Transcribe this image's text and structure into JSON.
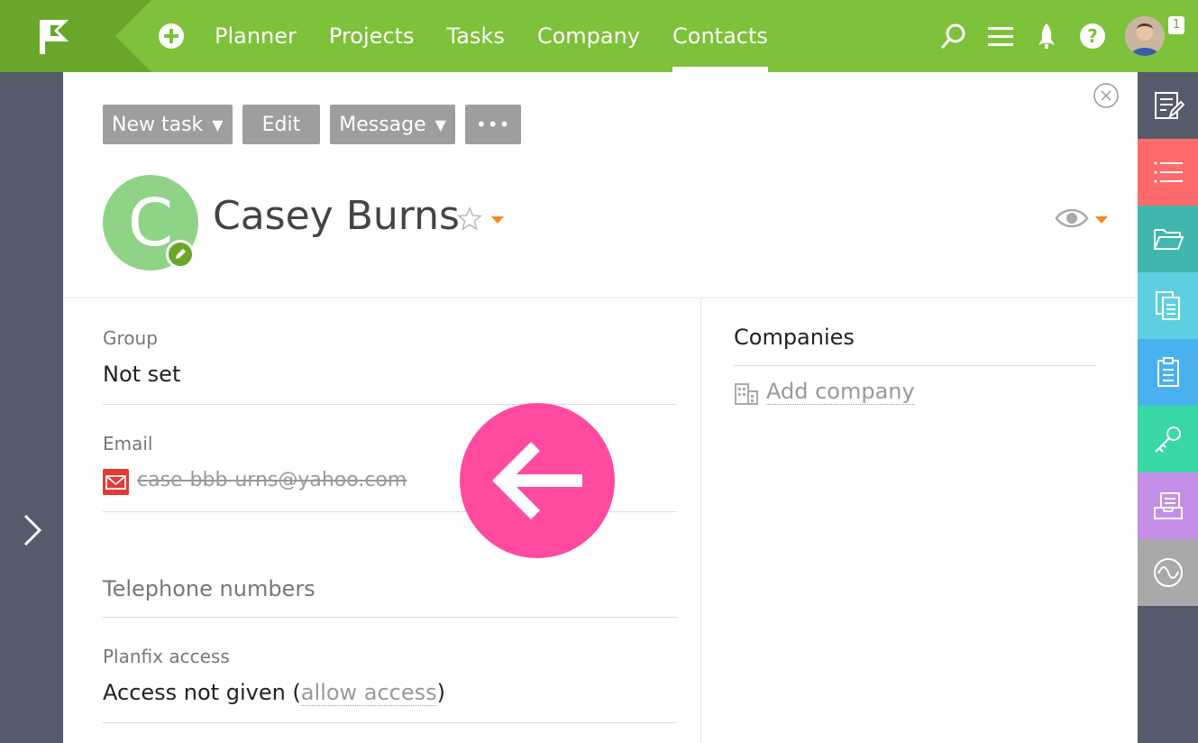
{
  "nav": {
    "items": [
      {
        "label": "Planner",
        "active": false
      },
      {
        "label": "Projects",
        "active": false
      },
      {
        "label": "Tasks",
        "active": false
      },
      {
        "label": "Company",
        "active": false
      },
      {
        "label": "Contacts",
        "active": true
      }
    ],
    "notification_count": "1"
  },
  "toolbar": {
    "new_task": "New task",
    "edit": "Edit",
    "message": "Message",
    "more": "•••",
    "caret": "▼"
  },
  "contact": {
    "initial": "C",
    "name": "Casey Burns"
  },
  "fields": {
    "group_label": "Group",
    "group_value": "Not set",
    "email_label": "Email",
    "email_value": "case-bbb-urns@yahoo.com",
    "telephone_label": "Telephone numbers",
    "access_label": "Planfix access",
    "access_value_prefix": "Access not given (",
    "access_link": "allow access",
    "access_value_suffix": ")"
  },
  "companies": {
    "title": "Companies",
    "add_company": "Add company"
  },
  "colors": {
    "topbar": "#7ec13a",
    "accent_orange": "#f28a1e",
    "pink_arrow": "#ff4aa0",
    "avatar_green": "#8fd387"
  },
  "right_sidebar": [
    {
      "icon": "notes-icon",
      "color": "#545b6b"
    },
    {
      "icon": "list-icon",
      "color": "#ff6b6b"
    },
    {
      "icon": "folder-icon",
      "color": "#3fb7ac"
    },
    {
      "icon": "documents-icon",
      "color": "#5cd0e0"
    },
    {
      "icon": "clipboard-icon",
      "color": "#48b1ee"
    },
    {
      "icon": "key-icon",
      "color": "#3ad8a6"
    },
    {
      "icon": "inbox-icon",
      "color": "#c48ee8"
    },
    {
      "icon": "analytics-icon",
      "color": "#a9a9a9"
    }
  ]
}
